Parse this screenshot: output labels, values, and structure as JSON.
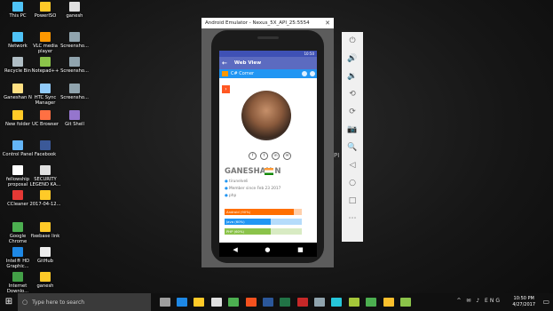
{
  "desktop": {
    "icons": [
      {
        "label": "This PC",
        "color": "#4fc3f7"
      },
      {
        "label": "PowerISO",
        "color": "#ffca28"
      },
      {
        "label": "ganesh",
        "color": "#e0e0e0"
      },
      {
        "label": "Network",
        "color": "#4fc3f7"
      },
      {
        "label": "VLC media player",
        "color": "#ff9800"
      },
      {
        "label": "Screensho...",
        "color": "#90a4ae"
      },
      {
        "label": "Recycle Bin",
        "color": "#b0bec5"
      },
      {
        "label": "Notepad++",
        "color": "#8bc34a"
      },
      {
        "label": "Screensho...",
        "color": "#90a4ae"
      },
      {
        "label": "Ganeshan N",
        "color": "#ffe082"
      },
      {
        "label": "HTC Sync Manager",
        "color": "#90caf9"
      },
      {
        "label": "Screensho...",
        "color": "#90a4ae"
      },
      {
        "label": "New folder",
        "color": "#ffca28"
      },
      {
        "label": "UC Browser",
        "color": "#ff7043"
      },
      {
        "label": "Git Shell",
        "color": "#9575cd"
      },
      {
        "label": "Control Panel",
        "color": "#64b5f6"
      },
      {
        "label": "Facebook",
        "color": "#3b5998"
      },
      {
        "label": "fellowship proposal",
        "color": "#ffffff"
      },
      {
        "label": "SECURITY LEGEND KA...",
        "color": "#e0e0e0"
      },
      {
        "label": "CCleaner",
        "color": "#e53935"
      },
      {
        "label": "2017-04-12...",
        "color": "#ffca28"
      },
      {
        "label": "Google Chrome",
        "color": "#4caf50"
      },
      {
        "label": "fixebase link",
        "color": "#ffca28"
      },
      {
        "label": "Intel® HD Graphic...",
        "color": "#1e88e5"
      },
      {
        "label": "GitHub",
        "color": "#eeeeee"
      },
      {
        "label": "Internet Downlo...",
        "color": "#43a047"
      },
      {
        "label": "ganesh",
        "color": "#ffca28"
      }
    ]
  },
  "emulator": {
    "title": "Android Emulator - Nexus_5X_API_25:5554",
    "close_glyph": "✕",
    "status_time": "10:50",
    "app_title": "Web View",
    "back_glyph": "←",
    "web_header": "C# Corner",
    "profile": {
      "name": "GANESHAN N",
      "location": "tirunelveli",
      "member_since": "Member since Feb 23 2017",
      "tech": "php",
      "skills": [
        {
          "label": "Android (90%)",
          "percent": 90,
          "color": "#ff6f00"
        },
        {
          "label": "Java (60%)",
          "percent": 60,
          "color": "#2196f3"
        },
        {
          "label": "PHP (60%)",
          "percent": 60,
          "color": "#8bc34a"
        }
      ],
      "social_icons": [
        "f",
        "t",
        "in",
        "✉"
      ]
    },
    "nav": {
      "back": "◀",
      "home": "●",
      "recent": "■"
    },
    "side_panel": [
      {
        "name": "power-icon",
        "glyph": "⏻"
      },
      {
        "name": "volume-up-icon",
        "glyph": "🔊"
      },
      {
        "name": "volume-down-icon",
        "glyph": "🔉"
      },
      {
        "name": "rotate-left-icon",
        "glyph": "⟲"
      },
      {
        "name": "rotate-right-icon",
        "glyph": "⟳"
      },
      {
        "name": "camera-icon",
        "glyph": "📷"
      },
      {
        "name": "zoom-icon",
        "glyph": "🔍"
      },
      {
        "name": "back-icon",
        "glyph": "◁"
      },
      {
        "name": "home-icon",
        "glyph": "○"
      },
      {
        "name": "overview-icon",
        "glyph": "□"
      },
      {
        "name": "more-icon",
        "glyph": "⋯"
      }
    ],
    "cropped_text": "PI"
  },
  "taskbar": {
    "search_placeholder": "Type here to search",
    "time": "10:50 PM",
    "date": "4/27/2017",
    "tray": "^ ✉ ♪ ENG",
    "notification_glyph": "▭",
    "pinned": [
      {
        "name": "task-view-icon",
        "color": "#9e9e9e"
      },
      {
        "name": "edge-icon",
        "color": "#1e88e5"
      },
      {
        "name": "explorer-icon",
        "color": "#ffca28"
      },
      {
        "name": "store-icon",
        "color": "#e0e0e0"
      },
      {
        "name": "chrome-icon",
        "color": "#4caf50"
      },
      {
        "name": "media-icon",
        "color": "#f4511e"
      },
      {
        "name": "word-icon",
        "color": "#2b579a"
      },
      {
        "name": "excel-icon",
        "color": "#217346"
      },
      {
        "name": "acrobat-icon",
        "color": "#c62828"
      },
      {
        "name": "app-icon",
        "color": "#90a4ae"
      },
      {
        "name": "paint-icon",
        "color": "#26c6da"
      },
      {
        "name": "android-icon",
        "color": "#a4c639"
      },
      {
        "name": "hangouts-icon",
        "color": "#4caf50"
      },
      {
        "name": "sticky-icon",
        "color": "#fbc02d"
      },
      {
        "name": "android-studio-icon",
        "color": "#8bc34a"
      }
    ]
  }
}
